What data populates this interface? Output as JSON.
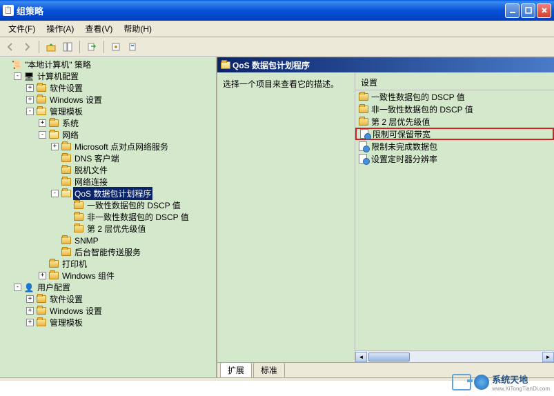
{
  "window": {
    "title": "组策略"
  },
  "menu": {
    "file": "文件(F)",
    "action": "操作(A)",
    "view": "查看(V)",
    "help": "帮助(H)"
  },
  "tree": {
    "root": "\"本地计算机\" 策略",
    "computer_config": "计算机配置",
    "software_settings": "软件设置",
    "windows_settings": "Windows 设置",
    "admin_templates": "管理模板",
    "system": "系统",
    "network": "网络",
    "ms_p2p": "Microsoft 点对点网络服务",
    "dns_client": "DNS 客户端",
    "offline_files": "脱机文件",
    "net_connections": "网络连接",
    "qos_scheduler": "QoS 数据包计划程序",
    "consistent_dscp": "一致性数据包的 DSCP 值",
    "inconsistent_dscp": "非一致性数据包的 DSCP 值",
    "layer2_priority": "第 2 层优先级值",
    "snmp": "SNMP",
    "bits": "后台智能传送服务",
    "printers": "打印机",
    "windows_components": "Windows 组件",
    "user_config": "用户配置",
    "u_software_settings": "软件设置",
    "u_windows_settings": "Windows 设置",
    "u_admin_templates": "管理模板"
  },
  "content": {
    "header": "QoS 数据包计划程序",
    "description": "选择一个项目来查看它的描述。",
    "column_header": "设置",
    "items": [
      {
        "label": "一致性数据包的 DSCP 值",
        "type": "folder"
      },
      {
        "label": "非一致性数据包的 DSCP 值",
        "type": "folder"
      },
      {
        "label": "第 2 层优先级值",
        "type": "folder"
      },
      {
        "label": "限制可保留带宽",
        "type": "setting",
        "highlighted": true
      },
      {
        "label": "限制未完成数据包",
        "type": "setting"
      },
      {
        "label": "设置定时器分辨率",
        "type": "setting"
      }
    ]
  },
  "tabs": {
    "extended": "扩展",
    "standard": "标准"
  },
  "watermark": {
    "text": "系统天地",
    "url": "www.XiTongTianDi.com"
  }
}
